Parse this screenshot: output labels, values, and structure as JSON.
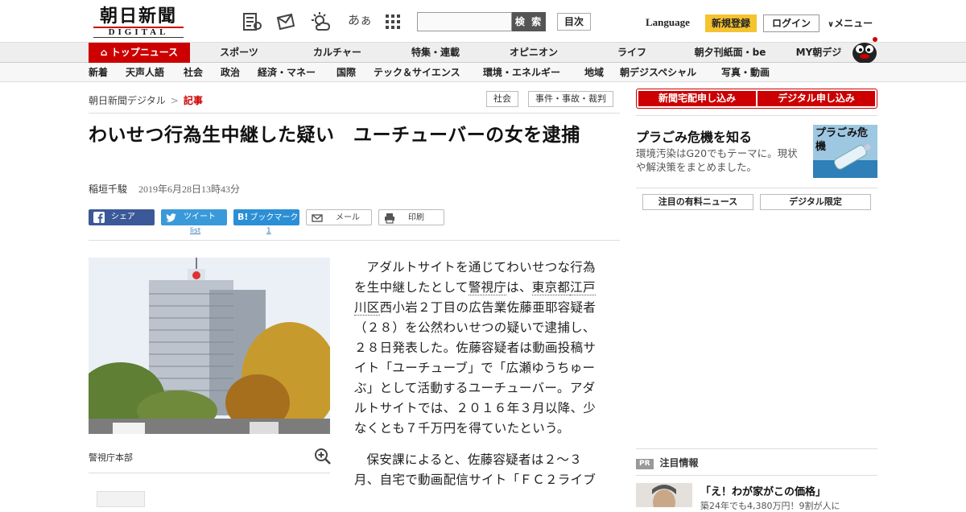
{
  "header": {
    "logo_jp": "朝日新聞",
    "logo_en": "DIGITAL",
    "search_label": "検 索",
    "toc_label": "目次",
    "font_size_icon_text": "あぁ",
    "language_label": "Language",
    "signup_label": "新規登録",
    "login_label": "ログイン",
    "menu_label": "メニュー"
  },
  "nav_primary": {
    "top": "トップニュース",
    "items": [
      "スポーツ",
      "カルチャー",
      "特集・連載",
      "オピニオン",
      "ライフ",
      "朝夕刊紙面・be",
      "MY朝デジ"
    ]
  },
  "nav_secondary": {
    "items": [
      "新着",
      "天声人語",
      "社会",
      "政治",
      "経済・マネー",
      "国際",
      "テック＆サイエンス",
      "環境・エネルギー",
      "地域",
      "朝デジスペシャル",
      "写真・動画"
    ]
  },
  "breadcrumb": {
    "home": "朝日新聞デジタル",
    "sep": ">",
    "current": "記事"
  },
  "tags": [
    "社会",
    "事件・事故・裁判"
  ],
  "article": {
    "headline": "わいせつ行為生中継した疑い　ユーチューバーの女を逮捕",
    "author": "稲垣千駿",
    "date": "2019年6月28日13時43分",
    "photo_caption": "警視庁本部",
    "p1_a": "アダルトサイトを通じてわいせつな行為を生中継したとして",
    "p1_kw1": "警視庁",
    "p1_b": "は、",
    "p1_kw2": "東京都",
    "p1_kw3": "江戸川区",
    "p1_c": "西小岩２丁目の広告業佐藤亜耶容疑者（２８）を公然わいせつの疑いで逮捕し、２８日発表した。佐藤容疑者は動画投稿サイト「ユーチューブ」で「広瀬ゆうちゅーぶ」として活動するユーチューバー。アダルトサイトでは、２０１６年３月以降、少なくとも７千万円を得ていたという。",
    "p2": "保安課によると、佐藤容疑者は２～３月、自宅で動画配信サイト「ＦＣ２ライブ"
  },
  "share": {
    "facebook": "シェア",
    "twitter": "ツイート",
    "hatena": "ブックマーク",
    "mail": "メール",
    "print": "印刷",
    "twitter_count": "list",
    "hatena_count": "1"
  },
  "sidebar": {
    "sub_paper": "新聞宅配申し込み",
    "sub_digital": "デジタル申し込み",
    "promo_title": "プラごみ危機を知る",
    "promo_text": "環境汚染はG20でもテーマに。現状や解決策をまとめました。",
    "promo_img_text": "プラごみ危機",
    "tab_paid": "注目の有料ニュース",
    "tab_digital": "デジタル限定",
    "pr_badge": "PR",
    "pr_head": "注目情報",
    "pr_title": "「え！わが家がこの価格」",
    "pr_sub": "築24年でも4,380万円！9割が人に"
  },
  "colors": {
    "brand_red": "#cc0000",
    "signup_yellow": "#f5c230",
    "facebook": "#3b5998",
    "twitter": "#3a9ad9"
  }
}
